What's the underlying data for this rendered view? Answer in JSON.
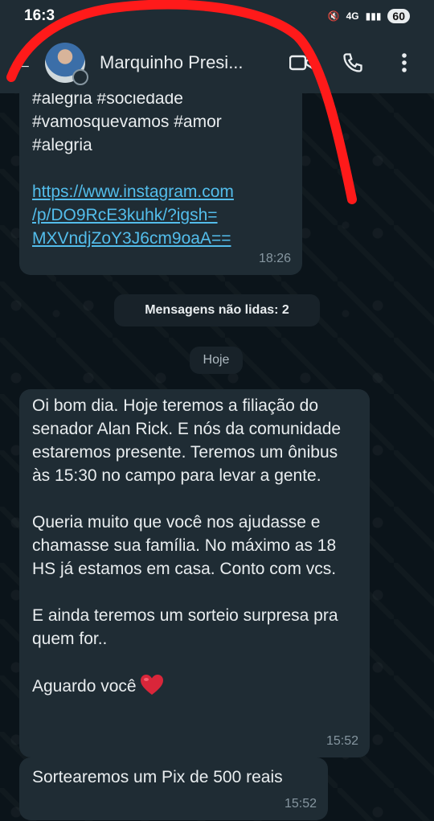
{
  "status_bar": {
    "time": "16:3",
    "network": "4G",
    "battery": "60"
  },
  "header": {
    "contact_name": "Marquinho Presi...",
    "back_icon": "arrow-left-icon",
    "video_icon": "video-camera-icon",
    "call_icon": "phone-icon",
    "menu_icon": "more-vertical-icon"
  },
  "messages": [
    {
      "text": "#alegria #sociedade\n#vamosquevamos #amor\n#alegria\n\n",
      "link": "https://www.instagram.com\n/p/DO9RcE3kuhk/?igsh=\nMXVndjZoY3J6cm9oaA==",
      "time": "18:26"
    },
    {
      "paragraphs": [
        "Oi bom dia. Hoje teremos a filiação do senador Alan Rick. E nós da comunidade estaremos presente. Teremos um ônibus às 15:30 no campo para levar a gente.",
        "Queria muito que você nos ajudasse e chamasse sua família. No máximo as 18 HS já estamos em casa. Conto com vcs.",
        "E ainda teremos um sorteio surpresa pra quem for..",
        "Aguardo você"
      ],
      "time": "15:52"
    },
    {
      "text": "Sortearemos um Pix de 500 reais",
      "time": "15:52"
    }
  ],
  "unread_label": "Mensagens não lidas: 2",
  "date_label": "Hoje",
  "colors": {
    "background": "#0b141a",
    "bubble": "#1f2c34",
    "link": "#53bdeb",
    "scribble": "#ff1a1a"
  }
}
